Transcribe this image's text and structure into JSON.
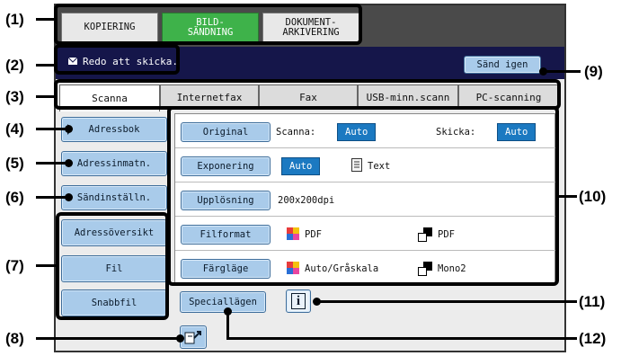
{
  "callouts": {
    "c1": "(1)",
    "c2": "(2)",
    "c3": "(3)",
    "c4": "(4)",
    "c5": "(5)",
    "c6": "(6)",
    "c7": "(7)",
    "c8": "(8)",
    "c9": "(9)",
    "c10": "(10)",
    "c11": "(11)",
    "c12": "(12)"
  },
  "mode_tabs": [
    "KOPIERING",
    "BILD-\nSÄNDNING",
    "DOKUMENT-\nARKIVERING"
  ],
  "status_text": "Redo att skicka.",
  "resend_label": "Sänd igen",
  "send_tabs": [
    "Scanna",
    "Internetfax",
    "Fax",
    "USB-minn.scann",
    "PC-scanning"
  ],
  "side_buttons": {
    "address_book": "Adressbok",
    "address_entry": "Adressinmatn.",
    "send_settings": "Sändinställn.",
    "address_overview": "Adressöversikt",
    "file": "Fil",
    "quick_file": "Snabbfil"
  },
  "settings": {
    "original": {
      "label": "Original",
      "scan_label": "Scanna:",
      "scan_value": "Auto",
      "send_label": "Skicka:",
      "send_value": "Auto"
    },
    "exposure": {
      "label": "Exponering",
      "value": "Auto",
      "text_mode": "Text"
    },
    "resolution": {
      "label": "Upplösning",
      "value": "200x200dpi"
    },
    "file_format": {
      "label": "Filformat",
      "color_value": "PDF",
      "mono_value": "PDF"
    },
    "color_mode": {
      "label": "Färgläge",
      "color_value": "Auto/Gråskala",
      "mono_value": "Mono2"
    }
  },
  "special_modes_label": "Speciallägen",
  "colors": {
    "active_tab": "#3eb24a",
    "button": "#a9cbea",
    "badge": "#1b79c1",
    "status_bar": "#15164a"
  }
}
